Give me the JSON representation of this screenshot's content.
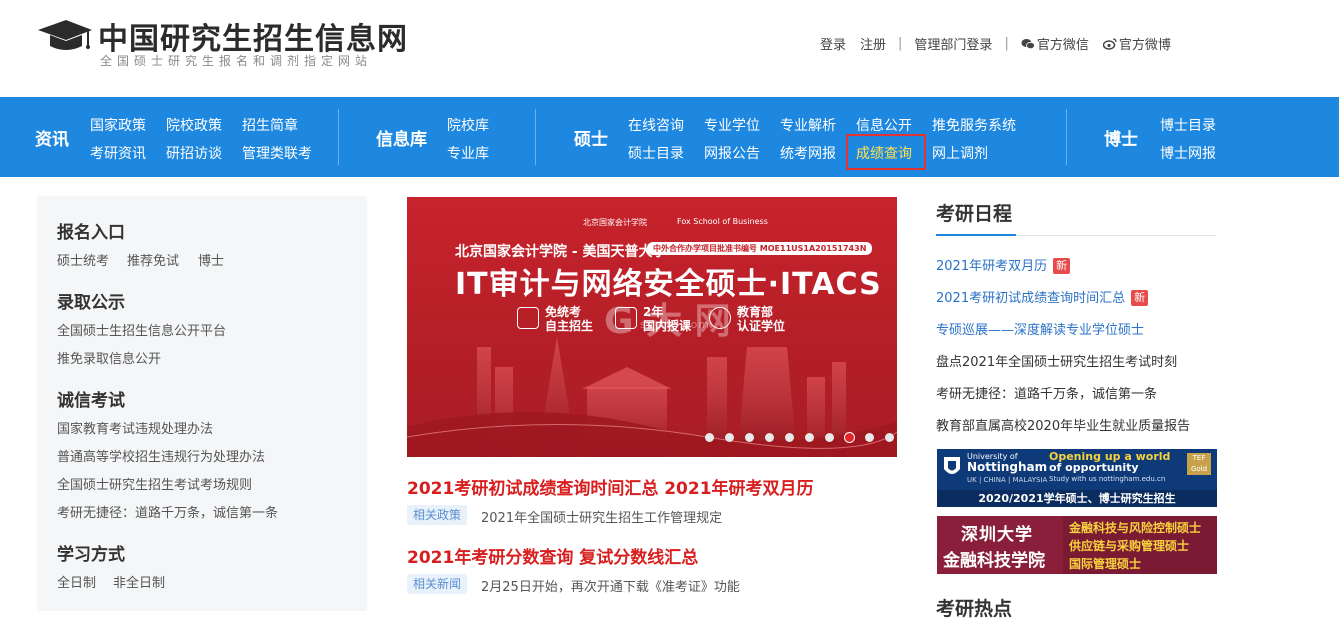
{
  "header": {
    "site_title": "中国研究生招生信息网",
    "site_subtitle": "全国硕士研究生报名和调剂指定网站",
    "links": {
      "login": "登录",
      "register": "注册",
      "admin_login": "管理部门登录",
      "wechat": "官方微信",
      "weibo": "官方微博"
    },
    "separator": "|"
  },
  "nav": {
    "news": {
      "label": "资讯",
      "items": [
        "国家政策",
        "院校政策",
        "招生简章",
        "考研资讯",
        "研招访谈",
        "管理类联考"
      ]
    },
    "database": {
      "label": "信息库",
      "items": [
        "院校库",
        "专业库"
      ]
    },
    "master": {
      "label": "硕士",
      "items": [
        "在线咨询",
        "专业学位",
        "专业解析",
        "信息公开",
        "推免服务系统",
        "硕士目录",
        "网报公告",
        "统考网报",
        "成绩查询",
        "网上调剂"
      ]
    },
    "phd": {
      "label": "博士",
      "items": [
        "博士目录",
        "博士网报"
      ]
    },
    "active_item": "成绩查询"
  },
  "sidebar": {
    "sections": [
      {
        "title": "报名入口",
        "links": [
          "硕士统考",
          "推荐免试",
          "博士"
        ]
      },
      {
        "title": "录取公示",
        "links": [
          "全国硕士生招生信息公开平台",
          "推免录取信息公开"
        ]
      },
      {
        "title": "诚信考试",
        "links": [
          "国家教育考试违规处理办法",
          "普通高等学校招生违规行为处理办法",
          "全国硕士研究生招生考试考场规则",
          "考研无捷径：道路千万条，诚信第一条"
        ]
      },
      {
        "title": "学习方式",
        "links": [
          "全日制",
          "非全日制"
        ]
      }
    ]
  },
  "banner": {
    "logo_a": "北京国家会计学院",
    "logo_b": "Fox School of Business",
    "line1": "北京国家会计学院 - 美国天普大学",
    "badge": "中外合作办学项目批准书编号 MOE11US1A20151743N",
    "title": "IT审计与网络安全硕士·ITACS",
    "features": [
      "免统考",
      "自主招生",
      "2年",
      "国内授课",
      "教育部",
      "认证学位"
    ],
    "dots_total": 10,
    "active_dot": 8,
    "watermark": "G 大 网",
    "watermark_sub": "sytem.com"
  },
  "news": [
    {
      "headline": "2021考研初试成绩查询时间汇总 2021年研考双月历",
      "tag": "相关政策",
      "sub": "2021年全国硕士研究生招生工作管理规定"
    },
    {
      "headline": "2021年考研分数查询 复试分数线汇总",
      "tag": "相关新闻",
      "sub": "2月25日开始，再次开通下载《准考证》功能"
    }
  ],
  "schedule": {
    "title": "考研日程",
    "items": [
      {
        "text": "2021年研考双月历",
        "new": "新",
        "color": "blue"
      },
      {
        "text": "2021考研初试成绩查询时间汇总",
        "new": "新",
        "color": "blue"
      },
      {
        "text": "专硕巡展——深度解读专业学位硕士",
        "new": "",
        "color": "blue"
      },
      {
        "text": "盘点2021年全国硕士研究生招生考试时刻",
        "new": "",
        "color": "dark"
      },
      {
        "text": "考研无捷径：道路千万条，诚信第一条",
        "new": "",
        "color": "dark"
      },
      {
        "text": "教育部直属高校2020年毕业生就业质量报告",
        "new": "",
        "color": "dark"
      }
    ],
    "hot_title": "考研热点"
  },
  "ads": {
    "nottingham": {
      "logo_a": "University of",
      "logo_b": "Nottingham",
      "logo_c": "UK | CHINA | MALAYSIA",
      "head1": "Opening up a world",
      "head2": "of opportunity",
      "small": "Study with us  nottingham.edu.cn",
      "tef": "TEF Gold",
      "bottom": "2020/2021学年硕士、博士研究生招生"
    },
    "shenzhen": {
      "left1": "深圳大学",
      "left2": "金融科技学院",
      "right": [
        "金融科技与风险控制硕士",
        "供应链与采购管理硕士",
        "国际管理硕士"
      ]
    }
  },
  "colors": {
    "nav_bg": "#1e88e0",
    "headline_red": "#d81e1e",
    "link_blue": "#2a72c7",
    "active_yellow": "#ffe14d",
    "banner_red": "#c8232c"
  }
}
